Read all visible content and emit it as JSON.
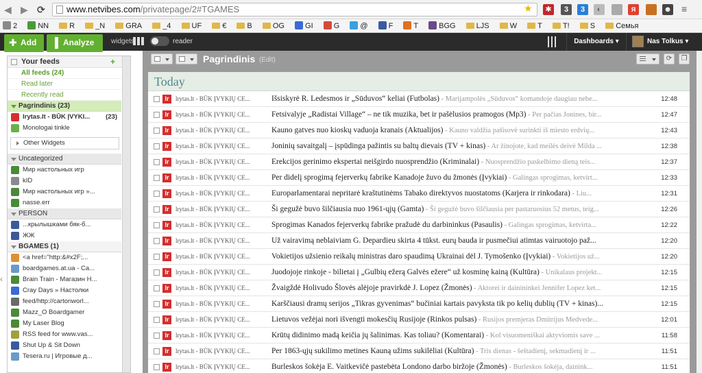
{
  "browser": {
    "url_host": "www.netvibes.com",
    "url_path": "/privatepage/2#TGAMES",
    "ext_badge": "3",
    "bookmarks": [
      "2",
      "NN",
      "R",
      "_N",
      "GRA",
      "_4",
      "UF",
      "€",
      "B",
      "OG",
      "GI",
      "G",
      "@",
      "F",
      "T",
      "BGG",
      "LJS",
      "W",
      "T",
      "T!",
      "S",
      "Семья"
    ]
  },
  "topbar": {
    "add_label": "Add",
    "analyze_label": "Analyze",
    "widgets_label": "widgets",
    "reader_label": "reader",
    "dashboards_label": "Dashboards ▾",
    "user_label": "Nas Tolkus ▾"
  },
  "sidebar": {
    "your_feeds": "Your feeds",
    "all_feeds": "All feeds (24)",
    "read_later": "Read later",
    "recently_read": "Recently read",
    "pagrindinis": "Pagrindinis (23)",
    "pagrindinis_items": [
      {
        "label": "lrytas.lt - BŪK ĮVYKI...",
        "count": "(23)"
      },
      {
        "label": "Monologai tinkle",
        "count": ""
      }
    ],
    "other_widgets": "Other Widgets",
    "uncategorized": "Uncategorized",
    "uncat_items": [
      "Мир настольных игр",
      "kID",
      "Мир настольных игр »...",
      "nasse.err"
    ],
    "person": "PERSON",
    "person_items": [
      "...крылышками бяк-б...",
      "ЖЖ"
    ],
    "bgames": "BGAMES (1)",
    "bgames_items": [
      "<a href=\"http:&#x2F;...",
      "boardgames.at.ua - Ca...",
      "Brain Train - Магазин Н...",
      "Cray Days » Настолки",
      "feed/http://cartonworl...",
      "Mazz_O Boardgamer",
      "My Laser Blog",
      "RSS feed for www.vas...",
      "Shut Up & Sit Down",
      "Tesera.ru | Игровые д..."
    ]
  },
  "main": {
    "tab_title": "Pagrindinis",
    "tab_edit": "(Edit)",
    "today": "Today",
    "source": "lrytas.lt - BŪK ĮVYKIŲ CE...",
    "rows": [
      {
        "title": "Išsiskyrė R. Ledesmos ir „Sūduvos“ keliai (Futbolas)",
        "snippet": " - Marijampolės „Sūduvos“ komandoje daugiau nebe...",
        "time": "12:48"
      },
      {
        "title": "Fetsivalyje „Radistai Village“ – ne tik muzika, bet ir pašėlusios pramogos (Mp3)",
        "snippet": " - Per pačias Jonines, bir...",
        "time": "12:47"
      },
      {
        "title": "Kauno gatves nuo kioskų vaduoja kranais (Aktualijos)",
        "snippet": " - Kauno valdžia pašisovė surinkti iš miesto erdvių...",
        "time": "12:43"
      },
      {
        "title": "Joninių savaitgalį – įspūdinga pažintis su baltų dievais (TV + kinas)",
        "snippet": " - Ar žinojote, kad meilės deivė Milda ...",
        "time": "12:38"
      },
      {
        "title": "Erekcijos gerinimo ekspertai neišgirdo nuosprendžio (Kriminalai)",
        "snippet": " - Nuosprendžio paskelbimo dieną teis...",
        "time": "12:37"
      },
      {
        "title": "Per didelį sprogimą fejerverkų fabrike Kanadoje žuvo du žmonės (Įvykiai)",
        "snippet": " - Galingas sprogimas, ketvirt...",
        "time": "12:33"
      },
      {
        "title": "Europarlamentarai nepritarė kraštutinėms Tabako direktyvos nuostatoms (Karjera ir rinkodara)",
        "snippet": " - Liu...",
        "time": "12:31"
      },
      {
        "title": "Ši gegužė buvo šilčiausia nuo 1961-ųjų (Gamta)",
        "snippet": " - Ši gegužė buvo šilčiausia per pastaruosius 52 metus, teig...",
        "time": "12:26"
      },
      {
        "title": "Sprogimas Kanados fejerverkų fabrike pražudė du darbininkus (Pasaulis)",
        "snippet": " - Galingas sprogimas, ketvirta...",
        "time": "12:22"
      },
      {
        "title": "Už vairavimą neblaiviam G. Depardieu skirta 4 tūkst. eurų bauda ir pusmečiui atimtas vairuotojo paž...",
        "snippet": "",
        "time": "12:20"
      },
      {
        "title": "Vokietijos užsienio reikalų ministras daro spaudimą Ukrainai dėl J. Tymošenko (Įvykiai)",
        "snippet": " - Vokietijos už...",
        "time": "12:20"
      },
      {
        "title": "Juodojoje rinkoje - bilietai į „Gulbių ežerą Galvės ežere“ už kosminę kainą (Kultūra)",
        "snippet": " - Unikalaus projekt...",
        "time": "12:15"
      },
      {
        "title": "Žvaigždė Holivudo Šlovės alėjoje pravirkdė J. Lopez (Žmonės)",
        "snippet": " - Aktorei ir dainininkei Jennifer Lopez ket...",
        "time": "12:15"
      },
      {
        "title": "Karščiausi dramų serijos „Tikras gyvenimas“ bučiniai kartais pavyksta tik po kelių dublių (TV + kinas)...",
        "snippet": "",
        "time": "12:15"
      },
      {
        "title": "Lietuvos vežėjai nori išvengti mokesčių Rusijoje (Rinkos pulsas)",
        "snippet": " - Rusijos premjeras Dmitrijus Medvede...",
        "time": "12:01"
      },
      {
        "title": "Krūtų didinimo madą keičia jų šalinimas. Kas toliau? (Komentarai)",
        "snippet": " - Kol visuomeniškai aktyviomis save ...",
        "time": "11:58"
      },
      {
        "title": "Per 1863-ųjų sukilimo metines Kauną užims sukilėliai (Kultūra)",
        "snippet": " - Tris dienas - šeštadienį, sekmadienį ir ...",
        "time": "11:51"
      },
      {
        "title": "Burleskos šokėja E. Vaitkevičė pastebėta Londono darbo biržoje (Žmonės)",
        "snippet": " - Burleskos šokėja, dainink...",
        "time": "11:51"
      }
    ]
  }
}
